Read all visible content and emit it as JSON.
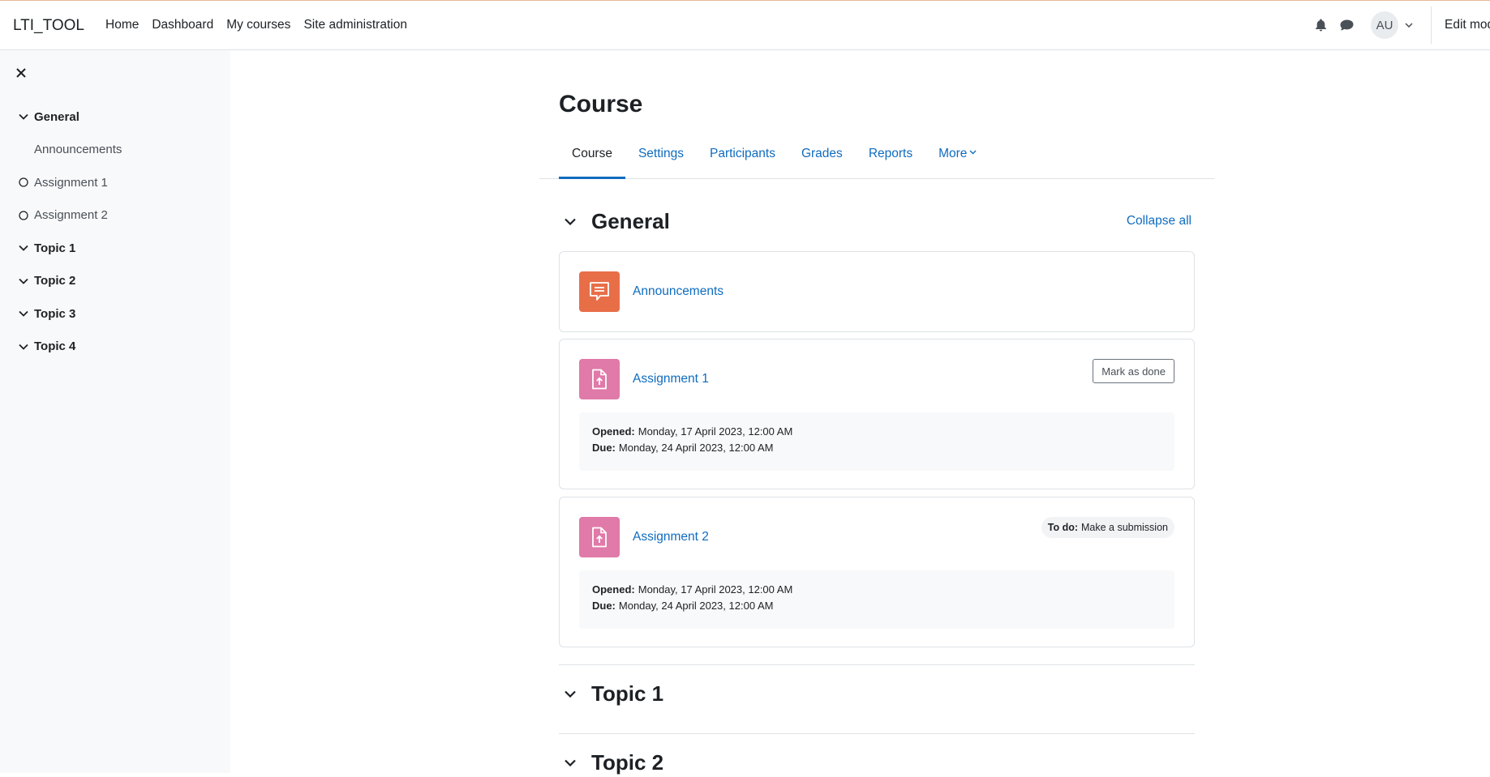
{
  "navbar": {
    "brand": "LTI_TOOL",
    "links": [
      "Home",
      "Dashboard",
      "My courses",
      "Site administration"
    ],
    "avatar_initials": "AU",
    "edit_mode_label": "Edit mode"
  },
  "drawer": {
    "items": [
      {
        "label": "General",
        "type": "section"
      },
      {
        "label": "Announcements",
        "type": "child"
      },
      {
        "label": "Assignment 1",
        "type": "activity"
      },
      {
        "label": "Assignment 2",
        "type": "activity"
      },
      {
        "label": "Topic 1",
        "type": "section"
      },
      {
        "label": "Topic 2",
        "type": "section"
      },
      {
        "label": "Topic 3",
        "type": "section"
      },
      {
        "label": "Topic 4",
        "type": "section"
      }
    ]
  },
  "page": {
    "title": "Course",
    "tabs": [
      "Course",
      "Settings",
      "Participants",
      "Grades",
      "Reports",
      "More"
    ],
    "active_tab": "Course"
  },
  "general": {
    "title": "General",
    "collapse_all": "Collapse all",
    "activities": [
      {
        "name": "Announcements",
        "icon": "forum-icon"
      },
      {
        "name": "Assignment 1",
        "icon": "assignment-icon",
        "action_label": "Mark as done",
        "opened_label": "Opened:",
        "opened": "Monday, 17 April 2023, 12:00 AM",
        "due_label": "Due:",
        "due": "Monday, 24 April 2023, 12:00 AM"
      },
      {
        "name": "Assignment 2",
        "icon": "assignment-icon",
        "todo_label": "To do:",
        "todo_text": "Make a submission",
        "opened_label": "Opened:",
        "opened": "Monday, 17 April 2023, 12:00 AM",
        "due_label": "Due:",
        "due": "Monday, 24 April 2023, 12:00 AM"
      }
    ]
  },
  "sections": [
    {
      "title": "Topic 1"
    },
    {
      "title": "Topic 2"
    }
  ],
  "colors": {
    "link": "#0f6cbf",
    "forum_icon_bg": "#e86e48",
    "assignment_icon_bg": "#e07aa8",
    "drawer_bg": "#f8f9fa"
  }
}
